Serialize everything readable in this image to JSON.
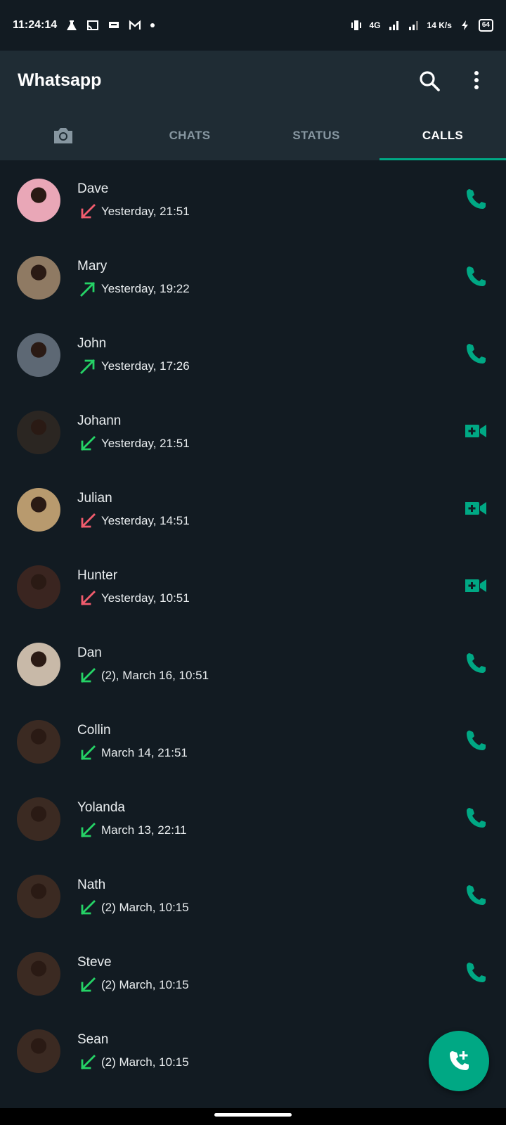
{
  "status_bar": {
    "time": "11:24:14",
    "network": "4G",
    "speed": "14 K/s",
    "battery": "64"
  },
  "app": {
    "title": "Whatsapp"
  },
  "tabs": [
    {
      "label": "CHATS"
    },
    {
      "label": "STATUS"
    },
    {
      "label": "CALLS"
    }
  ],
  "calls": [
    {
      "name": "Dave",
      "detail": "Yesterday, 21:51",
      "direction": "missed-incoming",
      "type": "voice",
      "avatar_color": "#e9a7b7"
    },
    {
      "name": "Mary",
      "detail": "Yesterday, 19:22",
      "direction": "outgoing",
      "type": "voice",
      "avatar_color": "#8f7a63"
    },
    {
      "name": "John",
      "detail": "Yesterday, 17:26",
      "direction": "outgoing",
      "type": "voice",
      "avatar_color": "#5d6874"
    },
    {
      "name": "Johann",
      "detail": "Yesterday, 21:51",
      "direction": "incoming",
      "type": "video",
      "avatar_color": "#2b2622"
    },
    {
      "name": "Julian",
      "detail": "Yesterday, 14:51",
      "direction": "missed-incoming",
      "type": "video",
      "avatar_color": "#b89a6e"
    },
    {
      "name": "Hunter",
      "detail": "Yesterday, 10:51",
      "direction": "missed-incoming",
      "type": "video",
      "avatar_color": "#3a2520"
    },
    {
      "name": "Dan",
      "detail": "(2), March 16, 10:51",
      "direction": "incoming",
      "type": "voice",
      "avatar_color": "#c8b9a8"
    },
    {
      "name": "Collin",
      "detail": "March 14, 21:51",
      "direction": "incoming",
      "type": "voice",
      "avatar_color": "#3b2a22"
    },
    {
      "name": "Yolanda",
      "detail": "March 13, 22:11",
      "direction": "incoming",
      "type": "voice",
      "avatar_color": "#3b2a22"
    },
    {
      "name": "Nath",
      "detail": "(2) March, 10:15",
      "direction": "incoming",
      "type": "voice",
      "avatar_color": "#3b2a22"
    },
    {
      "name": "Steve",
      "detail": "(2) March, 10:15",
      "direction": "incoming",
      "type": "voice",
      "avatar_color": "#3b2a22"
    },
    {
      "name": "Sean",
      "detail": "(2) March, 10:15",
      "direction": "incoming",
      "type": "voice",
      "avatar_color": "#3b2a22"
    }
  ],
  "colors": {
    "accent": "#00a884",
    "missed": "#f15c6d",
    "answered": "#25d366"
  }
}
